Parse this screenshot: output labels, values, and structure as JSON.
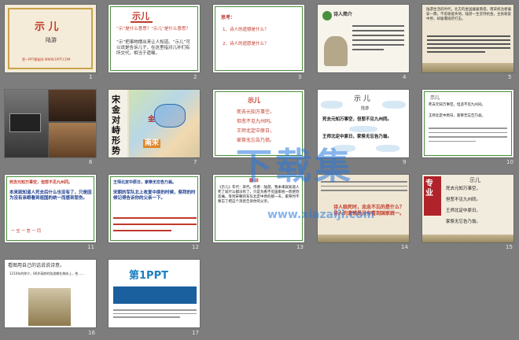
{
  "slides": [
    {
      "num": "1",
      "title": "示 儿",
      "subtitle": "陆游",
      "footer": "第一PPT模板网-WWW.1PPT.COM"
    },
    {
      "num": "2",
      "title": "示儿",
      "q1": "“示”是什么意思？“示儿”是什么意思？",
      "body": "“示”把事物摆出来让人知道。“示儿”可以说是告诉儿子，在这里指对儿孙们有所交代，相当于遗嘱。"
    },
    {
      "num": "3",
      "head": "思考：",
      "items": [
        "1、诗人的遗憾是什么？",
        "2、诗人的遗愿是什么？"
      ]
    },
    {
      "num": "4",
      "title": "诗人简介"
    },
    {
      "num": "5",
      "body": "陆游生活的时代，北方的金国屡屡南侵，南宋统治者偏安一隅，不思收复失地。陆游一生坚持抗金，主张收复中原，却屡遭排挤打击。"
    },
    {
      "num": "6"
    },
    {
      "num": "7",
      "title": "宋金对峙形势",
      "label_jin": "金",
      "label_song": "南宋"
    },
    {
      "num": "8",
      "title": "示儿",
      "lines": [
        "死去元知万事空，",
        "但悲不见九州同。",
        "王师北定中原日，",
        "家祭无忘告乃翁。"
      ]
    },
    {
      "num": "9",
      "title": "示 儿",
      "author": "陆游",
      "rows": [
        "死去元知万事空，但悲不见九州同。",
        "王师北定中原日，家祭无忘告乃翁。"
      ]
    },
    {
      "num": "10",
      "title": "示儿",
      "lines": [
        "死去元知万事空。但悲不见九州同。",
        "王师北定中原日，家祭无忘告乃翁。"
      ]
    },
    {
      "num": "11",
      "head": "死去元知万事空，但悲不见九州同。",
      "body": "本来就知道人死去后什么也没有了，只是因为没有亲眼看到祖国的统一而感到悲伤。",
      "foot": "一  空  一  悲  一  同"
    },
    {
      "num": "12",
      "head": "王师北定中原日，家祭无忘告乃翁。",
      "body": "宋朝的军队北上收复中原的时候，祭拜的时候记得告诉你的父亲一下。"
    },
    {
      "num": "13",
      "head": "翻 译",
      "body": "《示儿》年代：宋代。作者：陆游。我本来就知道人死了就什么都没有了，只是为看不见国家统一而感到悲痛。等到宋朝的军队北定中原的那一天，家祭时不要忘了把这个消息告诉你的父亲。"
    },
    {
      "num": "14",
      "body": "诗人临死时，念念不忘的是什么？诗人的遗憾是没有看到国家统一。",
      "hl": "国家统一"
    },
    {
      "num": "15",
      "title": "示儿",
      "lines": [
        "死去元知万事空，",
        "但悲不见九州同。",
        "王师北定中原日，",
        "家祭无忘告乃翁。"
      ],
      "banner": "专业"
    },
    {
      "num": "16",
      "head": "看图用自己的话说说诗意。",
      "body": "1210年的除夕，86岁高龄的陆游躺在病床上，他……"
    },
    {
      "num": "17",
      "logo": "第1PPT"
    }
  ],
  "watermark": {
    "main": "下载集",
    "url": "www.xiazaiji.com"
  }
}
